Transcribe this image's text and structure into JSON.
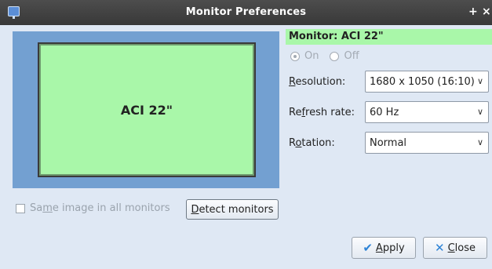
{
  "window": {
    "title": "Monitor Preferences",
    "maximize_glyph": "+",
    "close_glyph": "×",
    "icon": "monitor-app-icon"
  },
  "preview": {
    "monitor_label": "ACI 22\"",
    "background_color": "#73a0d1",
    "monitor_color": "#a9f7a9"
  },
  "same_image": {
    "label_pre": "Sa",
    "label_mnemonic": "m",
    "label_post": "e image in all monitors",
    "checked": false
  },
  "detect_button": {
    "label_mnemonic": "D",
    "label_post": "etect monitors"
  },
  "monitor_panel": {
    "header": "Monitor: ACI 22\"",
    "power": {
      "on_label": "On",
      "off_label": "Off",
      "selected": "On"
    }
  },
  "fields": {
    "resolution": {
      "label_mnemonic": "R",
      "label_post": "esolution:",
      "value": "1680 x 1050 (16:10)"
    },
    "refresh_rate": {
      "label_pre": "Re",
      "label_mnemonic": "f",
      "label_post": "resh rate:",
      "value": "60 Hz"
    },
    "rotation": {
      "label_pre": "R",
      "label_mnemonic": "o",
      "label_post": "tation:",
      "value": "Normal"
    }
  },
  "buttons": {
    "apply": {
      "label_mnemonic": "A",
      "label_post": "pply",
      "icon": "checkmark-icon"
    },
    "close": {
      "label_mnemonic": "C",
      "label_post": "lose",
      "icon": "x-icon"
    }
  },
  "colors": {
    "accent": "#2e83d6",
    "header_green": "#a9f7a9",
    "titlebar": "#3f3f3f",
    "body_bg": "#dfe8f4"
  }
}
